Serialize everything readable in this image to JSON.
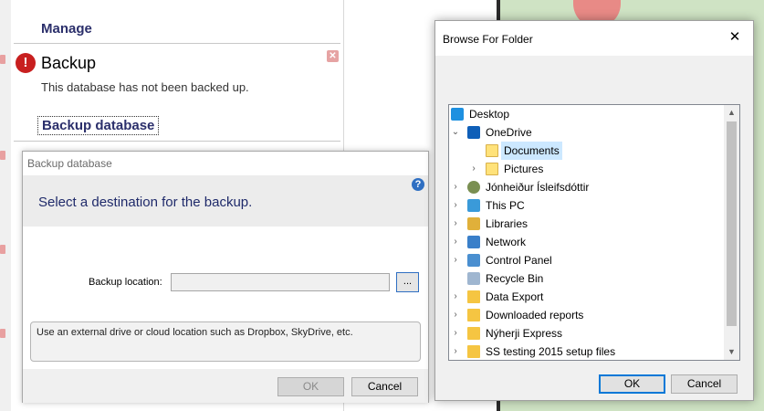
{
  "background_app": {
    "manage_title": "Manage",
    "backup_title": "Backup",
    "backup_subtitle": "This database has not been backed up.",
    "backup_link": "Backup database",
    "warning_icon": "!",
    "close_icon": "✕"
  },
  "backup_dialog": {
    "title": "Backup database",
    "header_text": "Select a destination for the backup.",
    "help_icon": "?",
    "location_label": "Backup location:",
    "location_value": "",
    "browse_label": "...",
    "hint": "Use an external drive or cloud location such as Dropbox, SkyDrive, etc.",
    "ok_label": "OK",
    "cancel_label": "Cancel"
  },
  "browse_dialog": {
    "title": "Browse For Folder",
    "close_icon": "✕",
    "ok_label": "OK",
    "cancel_label": "Cancel",
    "tree": [
      {
        "label": "Desktop",
        "icon": "desktop-icon",
        "arrow": ""
      },
      {
        "label": "OneDrive",
        "icon": "onedrive-icon",
        "arrow": "⌄"
      },
      {
        "label": "Documents",
        "icon": "folder-icon",
        "arrow": "",
        "selected": true
      },
      {
        "label": "Pictures",
        "icon": "folder-icon",
        "arrow": "›"
      },
      {
        "label": "Jónheiður Ísleifsdóttir",
        "icon": "user-icon",
        "arrow": "›"
      },
      {
        "label": "This PC",
        "icon": "pc-icon",
        "arrow": "›"
      },
      {
        "label": "Libraries",
        "icon": "libraries-icon",
        "arrow": "›"
      },
      {
        "label": "Network",
        "icon": "network-icon",
        "arrow": "›"
      },
      {
        "label": "Control Panel",
        "icon": "control-panel-icon",
        "arrow": "›"
      },
      {
        "label": "Recycle Bin",
        "icon": "recycle-bin-icon",
        "arrow": ""
      },
      {
        "label": "Data Export",
        "icon": "folder-icon",
        "arrow": "›"
      },
      {
        "label": "Downloaded reports",
        "icon": "folder-icon",
        "arrow": "›"
      },
      {
        "label": "Nýherji Express",
        "icon": "folder-icon",
        "arrow": "›"
      },
      {
        "label": "SS testing 2015 setup files",
        "icon": "folder-icon",
        "arrow": "›"
      }
    ],
    "scroll_up": "▲",
    "scroll_down": "▼"
  }
}
